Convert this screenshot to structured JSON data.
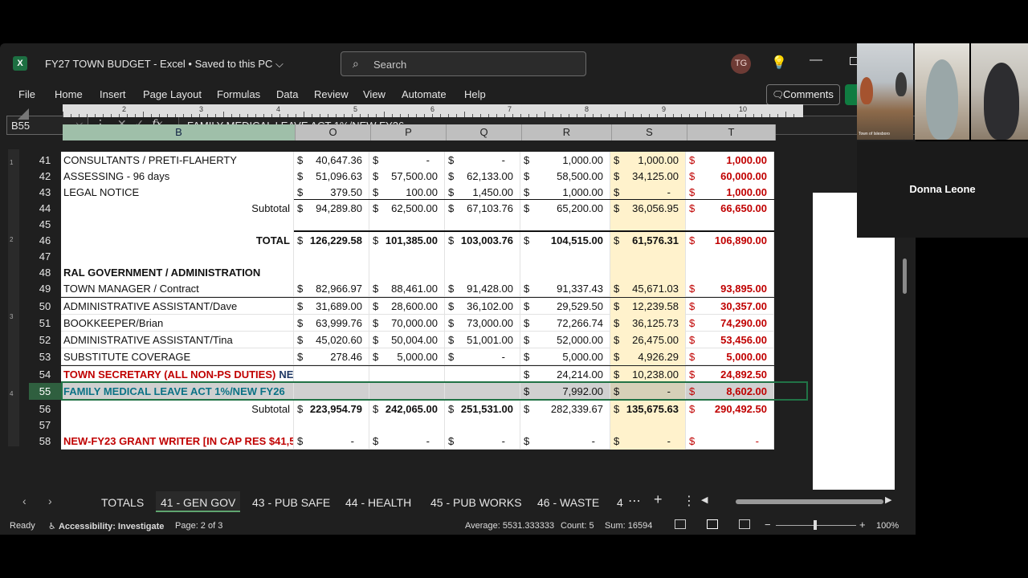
{
  "window": {
    "app_icon": "X",
    "title": "FY27 TOWN BUDGET  -  Excel  •  Saved to this PC",
    "search_placeholder": "Search",
    "user_initials": "TG"
  },
  "menu": [
    "File",
    "Home",
    "Insert",
    "Page Layout",
    "Formulas",
    "Data",
    "Review",
    "View",
    "Automate",
    "Help"
  ],
  "comments_label": "Comments",
  "formula_bar": {
    "name_box": "B55",
    "formula": "FAMILY MEDICAL LEAVE ACT  1%/NEW FY26"
  },
  "ruler_numbers": [
    "2",
    "3",
    "4",
    "5",
    "6",
    "7",
    "8",
    "9",
    "10"
  ],
  "vruler_numbers": [
    "1",
    "2",
    "3",
    "4"
  ],
  "columns": [
    "B",
    "O",
    "P",
    "Q",
    "R",
    "S",
    "T"
  ],
  "rows": [
    {
      "n": "41",
      "B": "CONSULTANTS / PRETI-FLAHERTY",
      "O": "40,647.36",
      "P": "-",
      "Q": "-",
      "R": "1,000.00",
      "S": "1,000.00",
      "T": "1,000.00"
    },
    {
      "n": "42",
      "B": "ASSESSING - 96 days",
      "O": "51,096.63",
      "P": "57,500.00",
      "Q": "62,133.00",
      "R": "58,500.00",
      "S": "34,125.00",
      "T": "60,000.00"
    },
    {
      "n": "43",
      "B": "LEGAL NOTICE",
      "O": "379.50",
      "P": "100.00",
      "Q": "1,450.00",
      "R": "1,000.00",
      "S": "-",
      "T": "1,000.00"
    },
    {
      "n": "44",
      "B": "Subtotal",
      "O": "94,289.80",
      "P": "62,500.00",
      "Q": "67,103.76",
      "R": "65,200.00",
      "S": "36,056.95",
      "T": "66,650.00"
    },
    {
      "n": "45",
      "B": ""
    },
    {
      "n": "46",
      "B": "TOTAL",
      "O": "126,229.58",
      "P": "101,385.00",
      "Q": "103,003.76",
      "R": "104,515.00",
      "S": "61,576.31",
      "T": "106,890.00"
    },
    {
      "n": "47",
      "B": ""
    },
    {
      "n": "48",
      "B": "RAL GOVERNMENT / ADMINISTRATION"
    },
    {
      "n": "49",
      "B": "TOWN MANAGER / Contract",
      "O": "82,966.97",
      "P": "88,461.00",
      "Q": "91,428.00",
      "R": "91,337.43",
      "S": "45,671.03",
      "T": "93,895.00"
    },
    {
      "n": "50",
      "B": "ADMINISTRATIVE ASSISTANT/Dave",
      "O": "31,689.00",
      "P": "28,600.00",
      "Q": "36,102.00",
      "R": "29,529.50",
      "S": "12,239.58",
      "T": "30,357.00"
    },
    {
      "n": "51",
      "B": "BOOKKEEPER/Brian",
      "O": "63,999.76",
      "P": "70,000.00",
      "Q": "73,000.00",
      "R": "72,266.74",
      "S": "36,125.73",
      "T": "74,290.00"
    },
    {
      "n": "52",
      "B": "ADMINISTRATIVE ASSISTANT/Tina",
      "O": "45,020.60",
      "P": "50,004.00",
      "Q": "51,001.00",
      "R": "52,000.00",
      "S": "26,475.00",
      "T": "53,456.00"
    },
    {
      "n": "53",
      "B": "SUBSTITUTE COVERAGE",
      "O": "278.46",
      "P": "5,000.00",
      "Q": "-",
      "R": "5,000.00",
      "S": "4,926.29",
      "T": "5,000.00"
    },
    {
      "n": "54",
      "B": "TOWN SECRETARY (ALL NON-PS DUTIES)",
      "B2": "NEW",
      "R": "24,214.00",
      "S": "10,238.00",
      "T": "24,892.50"
    },
    {
      "n": "55",
      "B": "FAMILY MEDICAL LEAVE ACT  1%/NEW FY26",
      "R": "7,992.00",
      "S": "-",
      "T": "8,602.00"
    },
    {
      "n": "56",
      "B": "Subtotal",
      "O": "223,954.79",
      "P": "242,065.00",
      "Q": "251,531.00",
      "R": "282,339.67",
      "S": "135,675.63",
      "T": "290,492.50"
    },
    {
      "n": "57",
      "B": ""
    },
    {
      "n": "58",
      "B": "NEW-FY23  GRANT WRITER   [IN CAP RES $41,5",
      "O": "-",
      "P": "-",
      "Q": "-",
      "R": "-",
      "S": "-",
      "T": "-"
    }
  ],
  "currency_symbol": "$",
  "tabs": [
    "TOTALS",
    "41 - GEN GOV",
    "43 - PUB SAFE",
    "44 - HEALTH",
    "45 - PUB WORKS",
    "46 - WASTE",
    "4"
  ],
  "active_tab": "41 - GEN GOV",
  "status": {
    "ready": "Ready",
    "accessibility": "Accessibility: Investigate",
    "page": "Page: 2 of 3",
    "average": "Average: 5531.333333",
    "count": "Count: 5",
    "sum": "Sum: 16594",
    "zoom": "100%"
  },
  "video": {
    "room_label": "Town of Islesboro",
    "speaker_name": "Donna Leone"
  },
  "colors": {
    "excel_green": "#217346",
    "red_values": "#c00000",
    "highlight_column": "#fff2cc"
  }
}
